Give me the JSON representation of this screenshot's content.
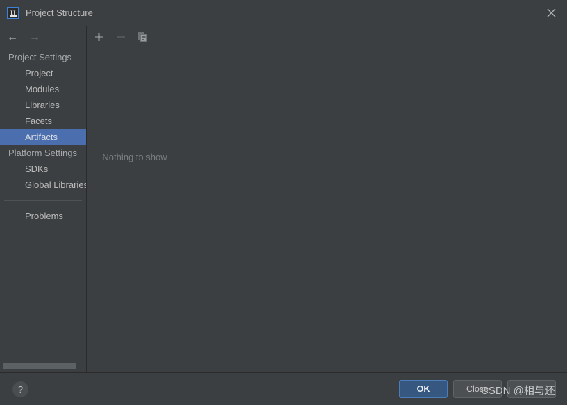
{
  "window": {
    "title": "Project Structure",
    "app_icon": "intellij-idea-icon",
    "close_icon": "close-icon"
  },
  "sidebar": {
    "nav": {
      "back_icon": "arrow-left-icon",
      "forward_icon": "arrow-right-icon"
    },
    "groups": [
      {
        "label": "Project Settings",
        "items": [
          {
            "label": "Project",
            "selected": false
          },
          {
            "label": "Modules",
            "selected": false
          },
          {
            "label": "Libraries",
            "selected": false
          },
          {
            "label": "Facets",
            "selected": false
          },
          {
            "label": "Artifacts",
            "selected": true
          }
        ]
      },
      {
        "label": "Platform Settings",
        "items": [
          {
            "label": "SDKs",
            "selected": false
          },
          {
            "label": "Global Libraries",
            "selected": false
          }
        ]
      }
    ],
    "footer_items": [
      {
        "label": "Problems",
        "selected": false
      }
    ],
    "scrollbar": "horizontal-scrollbar"
  },
  "middle_panel": {
    "toolbar": [
      {
        "name": "add-button",
        "glyph": "+",
        "enabled": true
      },
      {
        "name": "remove-button",
        "glyph": "−",
        "enabled": false
      },
      {
        "name": "copy-button",
        "glyph": "copy-icon",
        "enabled": false
      }
    ],
    "empty_message": "Nothing to show"
  },
  "bottom_bar": {
    "help_label": "?",
    "buttons": [
      {
        "label": "OK",
        "primary": true,
        "name": "ok-button"
      },
      {
        "label": "Close",
        "primary": false,
        "name": "close-button"
      },
      {
        "label": "",
        "primary": false,
        "name": "apply-button"
      }
    ]
  },
  "watermark": {
    "text": "CSDN @相与还"
  },
  "colors": {
    "background": "#3c3f41",
    "selection": "#4b6eaf",
    "primary_button": "#365880",
    "border": "#2b2b2b",
    "text": "#bbbbbb",
    "muted_text": "#7a7e80"
  }
}
